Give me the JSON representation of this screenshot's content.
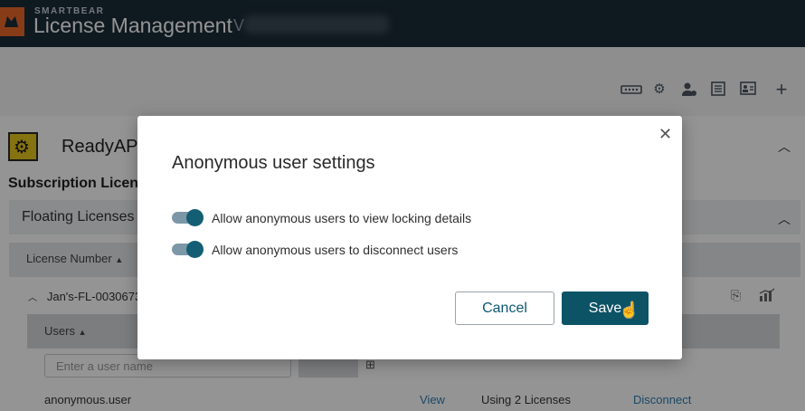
{
  "header": {
    "brand": "SMARTBEAR",
    "title": "License Management",
    "version_prefix": "V"
  },
  "toolbar": {
    "icons": [
      "password-icon",
      "settings-icon",
      "user-settings-icon",
      "list-icon",
      "user-card-icon",
      "add-icon"
    ]
  },
  "product": {
    "name": "ReadyAPI",
    "subscription_title": "Subscription Licens",
    "floating_label": "Floating Licenses",
    "license_column": "License Number",
    "license_row": "Jan's-FL-0030673",
    "users_column": "Users",
    "user_search_placeholder": "Enter a user name",
    "user_row": {
      "name": "anonymous.user",
      "view": "View",
      "status": "Using 2 Licenses",
      "action": "Disconnect"
    }
  },
  "modal": {
    "title": "Anonymous user settings",
    "toggles": [
      {
        "label": "Allow anonymous users to view locking details",
        "on": true
      },
      {
        "label": "Allow anonymous users to disconnect users",
        "on": true
      }
    ],
    "cancel_label": "Cancel",
    "save_label": "Save"
  },
  "colors": {
    "header_bg": "#1b2b38",
    "accent": "#0d5366",
    "toggle_knob": "#145e74",
    "link": "#2f7db0",
    "logo": "#e8682a"
  }
}
